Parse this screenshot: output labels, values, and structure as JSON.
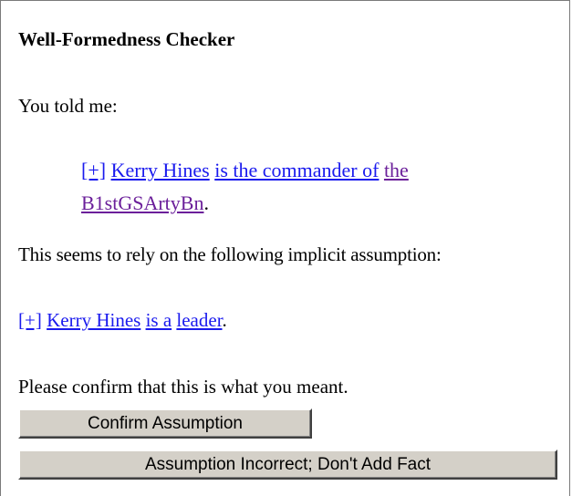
{
  "checker": {
    "title": "Well-Formedness Checker",
    "told_label": "You told me:",
    "fact": {
      "expand": "[+]",
      "subject": "Kerry Hines",
      "relation": "is the commander of",
      "object_line1": "the",
      "object_line2": "B1stGSArtyBn",
      "end": "."
    },
    "relies_text": "This seems to rely on the following implicit assumption:",
    "assumption": {
      "expand": "[+]",
      "subject": "Kerry Hines",
      "relation": "is a",
      "object": "leader",
      "end": "."
    },
    "confirm_prompt": "Please confirm that this is what you meant.",
    "buttons": {
      "confirm": "Confirm Assumption",
      "incorrect": "Assumption Incorrect; Don't Add Fact"
    }
  },
  "colors": {
    "link": "#1a1aee",
    "visited_link": "#6b1f9a",
    "button_face": "#d4d0c8"
  }
}
